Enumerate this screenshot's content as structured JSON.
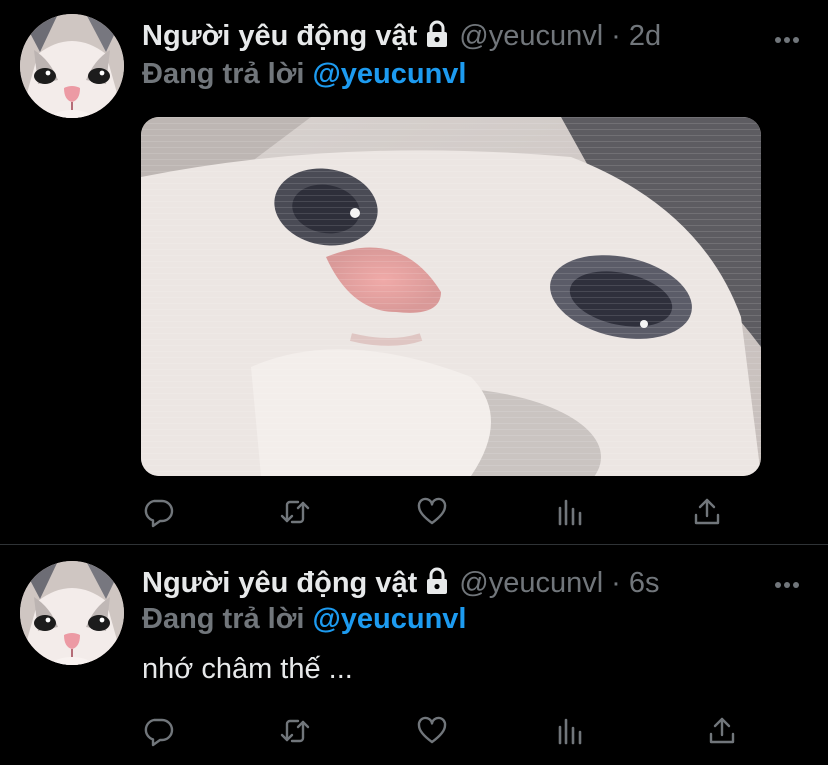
{
  "tweets": [
    {
      "author": {
        "display_name": "Người yêu động vật",
        "handle": "@yeucunvl",
        "protected": true
      },
      "time": "2d",
      "dot": "·",
      "reply_prefix": "Đang trả lời ",
      "reply_to": "@yeucunvl",
      "text": "",
      "has_media": true
    },
    {
      "author": {
        "display_name": "Người yêu động vật",
        "handle": "@yeucunvl",
        "protected": true
      },
      "time": "6s",
      "dot": "·",
      "reply_prefix": "Đang trả lời ",
      "reply_to": "@yeucunvl",
      "text": "nhớ châm thế ...",
      "has_media": false
    }
  ],
  "icons": {
    "more": "more-horizontal-icon",
    "lock": "lock-icon",
    "reply": "reply-icon",
    "retweet": "retweet-icon",
    "like": "like-icon",
    "views": "views-icon",
    "share": "share-icon"
  },
  "colors": {
    "background": "#000000",
    "text": "#e7e9ea",
    "secondary": "#71767b",
    "accent": "#1d9bf0",
    "divider": "#2f3336"
  }
}
